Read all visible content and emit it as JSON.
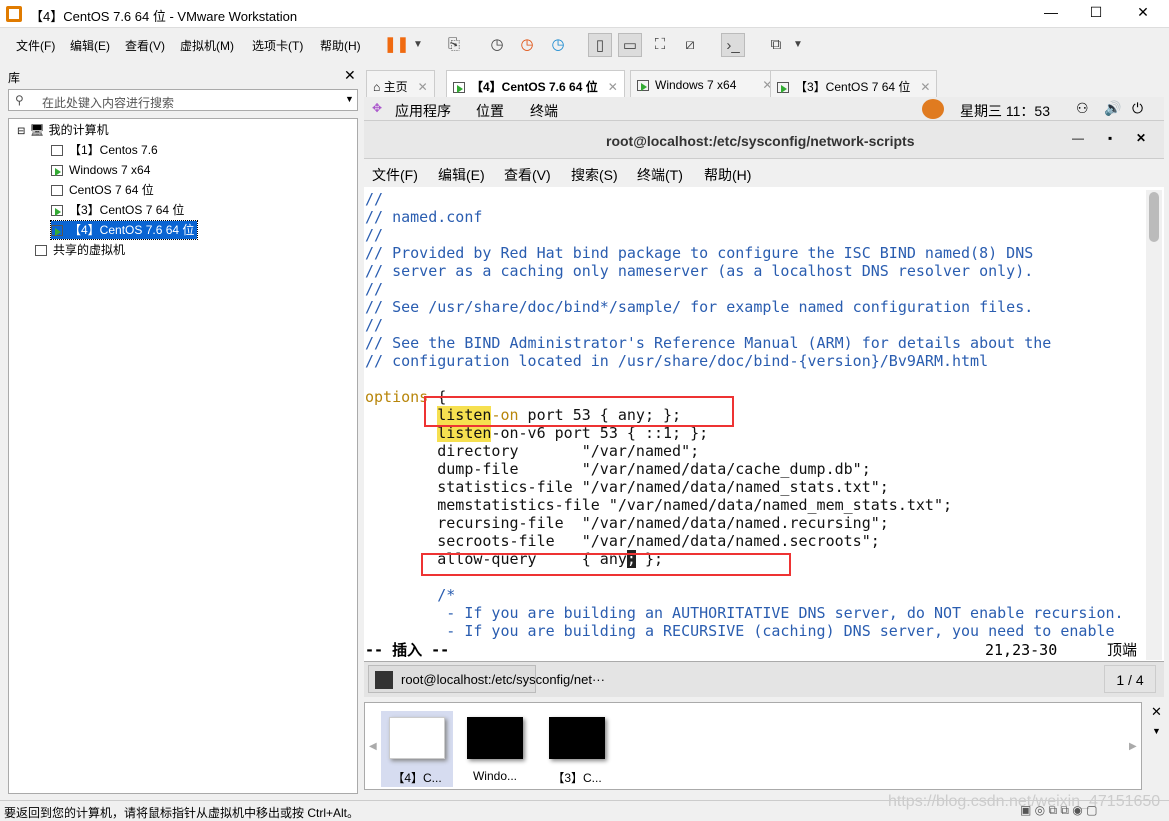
{
  "window": {
    "title": "【4】CentOS 7.6 64 位 - VMware Workstation"
  },
  "menu": [
    "文件(F)",
    "编辑(E)",
    "查看(V)",
    "虚拟机(M)",
    "选项卡(T)",
    "帮助(H)"
  ],
  "library": {
    "title": "库",
    "search_placeholder": "在此处键入内容进行搜索",
    "root": "我的计算机",
    "vms": [
      {
        "label": "【1】Centos 7.6",
        "running": false
      },
      {
        "label": "Windows 7 x64",
        "running": true
      },
      {
        "label": "CentOS 7 64 位",
        "running": false
      },
      {
        "label": "【3】CentOS 7 64 位",
        "running": true
      },
      {
        "label": "【4】CentOS 7.6 64 位",
        "running": true,
        "selected": true
      }
    ],
    "shared": "共享的虚拟机"
  },
  "tabs": [
    {
      "label": "主页"
    },
    {
      "label": "【4】CentOS 7.6 64 位",
      "active": true
    },
    {
      "label": "Windows 7 x64"
    },
    {
      "label": "【3】CentOS 7 64 位"
    }
  ],
  "gnome": {
    "apps": "应用程序",
    "places": "位置",
    "terminal": "终端",
    "clock": "星期三 11：53"
  },
  "terminal": {
    "title": "root@localhost:/etc/sysconfig/network-scripts",
    "menu": [
      "文件(F)",
      "编辑(E)",
      "查看(V)",
      "搜索(S)",
      "终端(T)",
      "帮助(H)"
    ],
    "lines": [
      [
        [
          "//",
          "cm"
        ]
      ],
      [
        [
          "// named.conf",
          "cm"
        ]
      ],
      [
        [
          "//",
          "cm"
        ]
      ],
      [
        [
          "// Provided by Red Hat bind package to configure the ISC BIND named(8) DNS",
          "cm"
        ]
      ],
      [
        [
          "// server as a caching only nameserver (as a localhost DNS resolver only).",
          "cm"
        ]
      ],
      [
        [
          "//",
          "cm"
        ]
      ],
      [
        [
          "// See /usr/share/doc/bind*/sample/ for example named configuration files.",
          "cm"
        ]
      ],
      [
        [
          "//",
          "cm"
        ]
      ],
      [
        [
          "// See the BIND Administrator's Reference Manual (ARM) for details about the",
          "cm"
        ]
      ],
      [
        [
          "// configuration located in /usr/share/doc/bind-{version}/Bv9ARM.html",
          "cm"
        ]
      ],
      [],
      [
        [
          "options",
          "kw"
        ],
        [
          " {",
          ""
        ]
      ],
      [
        [
          "        ",
          ""
        ],
        [
          "listen",
          "hl"
        ],
        [
          "-on",
          "kw"
        ],
        [
          " port 53 { any; };",
          ""
        ]
      ],
      [
        [
          "        ",
          ""
        ],
        [
          "listen",
          "hl"
        ],
        [
          "-on-v6 port 53 { ::1; };",
          ""
        ]
      ],
      [
        [
          "        directory       \"/var/named\";",
          ""
        ]
      ],
      [
        [
          "        dump-file       \"/var/named/data/cache_dump.db\";",
          ""
        ]
      ],
      [
        [
          "        statistics-file \"/var/named/data/named_stats.txt\";",
          ""
        ]
      ],
      [
        [
          "        memstatistics-file \"/var/named/data/named_mem_stats.txt\";",
          ""
        ]
      ],
      [
        [
          "        recursing-file  \"/var/named/data/named.recursing\";",
          ""
        ]
      ],
      [
        [
          "        secroots-file   \"/var/named/data/named.secroots\";",
          ""
        ]
      ],
      [
        [
          "        allow-query     { any",
          ""
        ],
        [
          ";",
          "cur"
        ],
        [
          " };",
          ""
        ]
      ],
      [],
      [
        [
          "        /*",
          "cm"
        ]
      ],
      [
        [
          "         - If you are building an AUTHORITATIVE DNS server, do NOT enable recursion.",
          "cm"
        ]
      ],
      [
        [
          "         - If you are building a RECURSIVE (caching) DNS server, you need to enable",
          "cm"
        ]
      ]
    ],
    "mode": "-- 插入 --",
    "position": "21,23-30",
    "scroll_pos": "顶端",
    "bottom_tab": "root@localhost:/etc/sysconfig/net···",
    "workspace": "1 / 4"
  },
  "thumbnails": [
    {
      "label": "【4】C..."
    },
    {
      "label": "Windo..."
    },
    {
      "label": "【3】C..."
    }
  ],
  "status": "要返回到您的计算机，请将鼠标指针从虚拟机中移出或按 Ctrl+Alt。",
  "watermark": "https://blog.csdn.net/weixin_47151650"
}
